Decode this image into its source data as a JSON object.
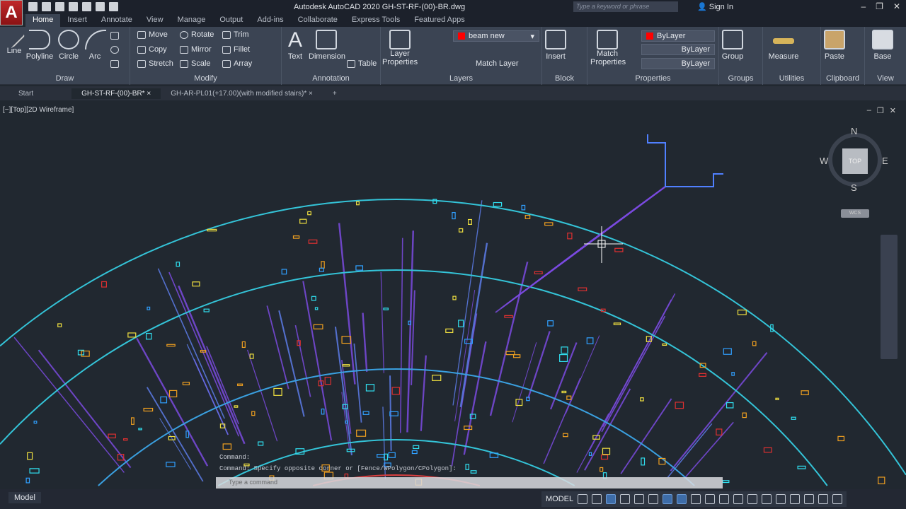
{
  "title": "Autodesk AutoCAD 2020   GH-ST-RF-(00)-BR.dwg",
  "app_logo": "A",
  "search_placeholder": "Type a keyword or phrase",
  "sign_in": "Sign In",
  "ribbon_tabs": [
    "Home",
    "Insert",
    "Annotate",
    "View",
    "Manage",
    "Output",
    "Add-ins",
    "Collaborate",
    "Express Tools",
    "Featured Apps"
  ],
  "draw": {
    "title": "Draw",
    "line": "Line",
    "polyline": "Polyline",
    "circle": "Circle",
    "arc": "Arc"
  },
  "modify": {
    "title": "Modify",
    "move": "Move",
    "rotate": "Rotate",
    "trim": "Trim",
    "copy": "Copy",
    "mirror": "Mirror",
    "fillet": "Fillet",
    "stretch": "Stretch",
    "scale": "Scale",
    "array": "Array"
  },
  "annotation": {
    "title": "Annotation",
    "text": "Text",
    "dimension": "Dimension",
    "table": "Table"
  },
  "layers": {
    "title": "Layers",
    "layer_properties": "Layer Properties",
    "current_layer": "beam new",
    "match_layer": "Match Layer"
  },
  "block": {
    "title": "Block",
    "insert": "Insert"
  },
  "properties": {
    "title": "Properties",
    "match_properties": "Match Properties",
    "color": "ByLayer",
    "linetype": "ByLayer",
    "lineweight": "ByLayer"
  },
  "groups": {
    "title": "Groups",
    "group": "Group"
  },
  "utilities": {
    "title": "Utilities",
    "measure": "Measure"
  },
  "clipboard": {
    "title": "Clipboard",
    "paste": "Paste"
  },
  "view": {
    "title": "View",
    "base": "Base"
  },
  "doc_tabs": [
    "Start",
    "GH-ST-RF-(00)-BR*",
    "GH-AR-PL01(+17.00)(with modified stairs)*"
  ],
  "viewport_label": "[−][Top][2D Wireframe]",
  "viewcube": {
    "n": "N",
    "s": "S",
    "e": "E",
    "w": "W",
    "top": "TOP",
    "wcs": "WCS"
  },
  "command_history": [
    "Command:",
    "Command: Specify opposite corner or [Fence/WPolygon/CPolygon]:"
  ],
  "command_placeholder": "Type a command",
  "layout_tabs": [
    "Model"
  ],
  "status_model": "MODEL",
  "accent": "#3d6ca8"
}
